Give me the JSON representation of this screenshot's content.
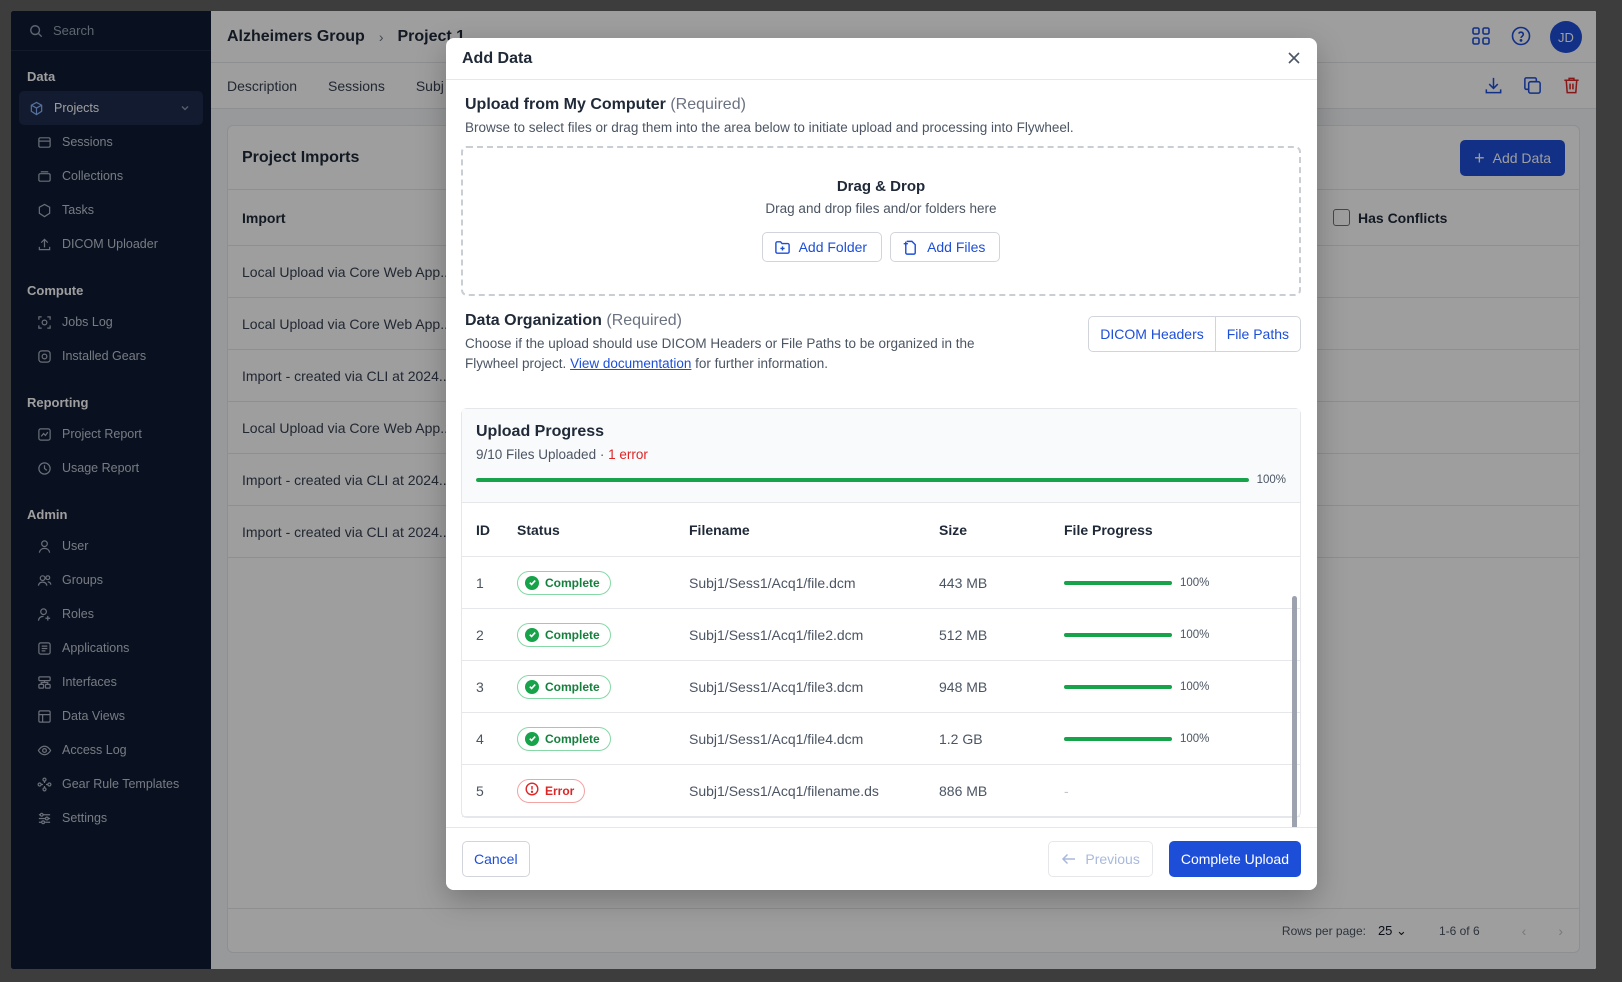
{
  "sidebar": {
    "search_label": "Search",
    "sections": [
      {
        "title": "Data",
        "items": [
          {
            "label": "Projects",
            "icon": "cube-icon",
            "active": true
          },
          {
            "label": "Sessions",
            "icon": "sessions-icon"
          },
          {
            "label": "Collections",
            "icon": "collections-icon"
          },
          {
            "label": "Tasks",
            "icon": "tasks-icon"
          },
          {
            "label": "DICOM Uploader",
            "icon": "upload-icon"
          }
        ]
      },
      {
        "title": "Compute",
        "items": [
          {
            "label": "Jobs Log",
            "icon": "jobs-icon"
          },
          {
            "label": "Installed Gears",
            "icon": "gear-icon"
          }
        ]
      },
      {
        "title": "Reporting",
        "items": [
          {
            "label": "Project Report",
            "icon": "report-icon"
          },
          {
            "label": "Usage Report",
            "icon": "usage-icon"
          }
        ]
      },
      {
        "title": "Admin",
        "items": [
          {
            "label": "User",
            "icon": "user-icon"
          },
          {
            "label": "Groups",
            "icon": "groups-icon"
          },
          {
            "label": "Roles",
            "icon": "roles-icon"
          },
          {
            "label": "Applications",
            "icon": "applications-icon"
          },
          {
            "label": "Interfaces",
            "icon": "interfaces-icon"
          },
          {
            "label": "Data Views",
            "icon": "table-icon"
          },
          {
            "label": "Access Log",
            "icon": "eye-icon"
          },
          {
            "label": "Gear Rule Templates",
            "icon": "rules-icon"
          },
          {
            "label": "Settings",
            "icon": "sliders-icon"
          }
        ]
      }
    ]
  },
  "header": {
    "breadcrumb": [
      "Alzheimers Group",
      "Project 1"
    ],
    "avatar_initials": "JD"
  },
  "tabs": [
    "Description",
    "Sessions",
    "Subj"
  ],
  "imports": {
    "title": "Project Imports",
    "add_data_label": "Add Data",
    "column_import": "Import",
    "has_conflicts_label": "Has Conflicts",
    "rows": [
      "Local Upload via Core Web App...",
      "Local Upload via Core Web App...",
      "Import - created via CLI at 2024...",
      "Local Upload via Core Web App...",
      "Import - created via CLI at 2024...",
      "Import - created via CLI at 2024..."
    ],
    "pager": {
      "rows_label": "Rows per page:",
      "rows_value": "25",
      "range": "1-6 of 6"
    }
  },
  "modal": {
    "title": "Add Data",
    "upload": {
      "heading": "Upload from My Computer",
      "required": "(Required)",
      "description": "Browse to select files or drag them into the area below to initiate upload and processing into Flywheel.",
      "drop_title": "Drag & Drop",
      "drop_sub": "Drag and drop files and/or folders here",
      "add_folder": "Add Folder",
      "add_files": "Add Files"
    },
    "organization": {
      "heading": "Data Organization",
      "required": "(Required)",
      "desc_pre": "Choose if the upload should use DICOM Headers or File Paths to be organized in the Flywheel project.",
      "link": "View documentation",
      "desc_post": "for further information.",
      "option_dicom": "DICOM Headers",
      "option_paths": "File Paths"
    },
    "progress": {
      "title": "Upload Progress",
      "files_text": "9/10 Files Uploaded",
      "separator": "·",
      "error_text": "1 error",
      "overall_percent": 100,
      "overall_label": "100%",
      "columns": [
        "ID",
        "Status",
        "Filename",
        "Size",
        "File Progress"
      ],
      "rows": [
        {
          "id": "1",
          "status": "Complete",
          "filename": "Subj1/Sess1/Acq1/file.dcm",
          "size": "443 MB",
          "progress": 100,
          "progress_label": "100%"
        },
        {
          "id": "2",
          "status": "Complete",
          "filename": "Subj1/Sess1/Acq1/file2.dcm",
          "size": "512 MB",
          "progress": 100,
          "progress_label": "100%"
        },
        {
          "id": "3",
          "status": "Complete",
          "filename": "Subj1/Sess1/Acq1/file3.dcm",
          "size": "948 MB",
          "progress": 100,
          "progress_label": "100%"
        },
        {
          "id": "4",
          "status": "Complete",
          "filename": "Subj1/Sess1/Acq1/file4.dcm",
          "size": "1.2 GB",
          "progress": 100,
          "progress_label": "100%"
        },
        {
          "id": "5",
          "status": "Error",
          "filename": "Subj1/Sess1/Acq1/filename.ds",
          "size": "886 MB",
          "progress": null,
          "progress_label": "-"
        }
      ]
    },
    "footer": {
      "cancel": "Cancel",
      "previous": "Previous",
      "complete": "Complete Upload"
    }
  },
  "colors": {
    "primary": "#1d4ed8",
    "success": "#16a34a",
    "error": "#dc2626",
    "sidebar": "#0f1b33"
  }
}
